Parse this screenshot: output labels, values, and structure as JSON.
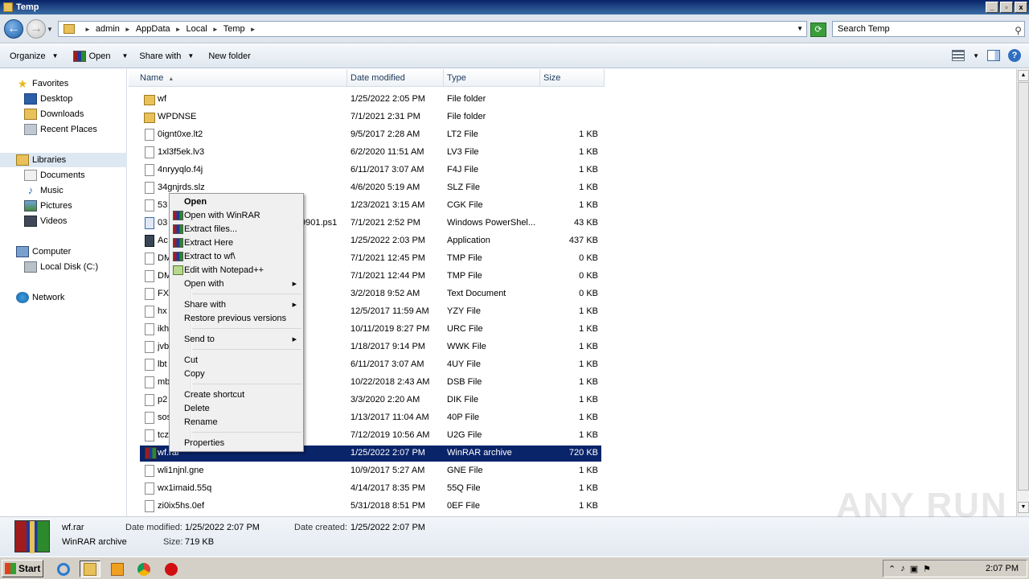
{
  "window": {
    "title": "Temp",
    "buttons": [
      "_",
      "▫",
      "x"
    ]
  },
  "address": {
    "crumbs": [
      "admin",
      "AppData",
      "Local",
      "Temp"
    ],
    "search_placeholder": "Search Temp"
  },
  "toolbar": {
    "organize": "Organize",
    "open": "Open",
    "share_with": "Share with",
    "new_folder": "New folder"
  },
  "nav": {
    "favorites": "Favorites",
    "desktop": "Desktop",
    "downloads": "Downloads",
    "recent_places": "Recent Places",
    "libraries": "Libraries",
    "documents": "Documents",
    "music": "Music",
    "pictures": "Pictures",
    "videos": "Videos",
    "computer": "Computer",
    "local_disk": "Local Disk (C:)",
    "network": "Network"
  },
  "columns": {
    "name": "Name",
    "date": "Date modified",
    "type": "Type",
    "size": "Size"
  },
  "files": [
    {
      "name": "wf",
      "date": "1/25/2022 2:05 PM",
      "type": "File folder",
      "size": "",
      "icon": "folder"
    },
    {
      "name": "WPDNSE",
      "date": "7/1/2021 2:31 PM",
      "type": "File folder",
      "size": "",
      "icon": "folder"
    },
    {
      "name": "0ignt0xe.lt2",
      "date": "9/5/2017 2:28 AM",
      "type": "LT2 File",
      "size": "1 KB",
      "icon": "file"
    },
    {
      "name": "1xl3f5ek.lv3",
      "date": "6/2/2020 11:51 AM",
      "type": "LV3 File",
      "size": "1 KB",
      "icon": "file"
    },
    {
      "name": "4nryyqlo.f4j",
      "date": "6/11/2017 3:07 AM",
      "type": "F4J File",
      "size": "1 KB",
      "icon": "file"
    },
    {
      "name": "34gnjrds.slz",
      "date": "4/6/2020 5:19 AM",
      "type": "SLZ File",
      "size": "1 KB",
      "icon": "file"
    },
    {
      "name": "53",
      "date": "1/23/2021 3:15 AM",
      "type": "CGK File",
      "size": "1 KB",
      "icon": "file"
    },
    {
      "name": "03",
      "name_tail": "9901.ps1",
      "date": "7/1/2021 2:52 PM",
      "type": "Windows PowerShel...",
      "size": "43 KB",
      "icon": "ps"
    },
    {
      "name": "Ac",
      "date": "1/25/2022 2:03 PM",
      "type": "Application",
      "size": "437 KB",
      "icon": "app"
    },
    {
      "name": "DM",
      "date": "7/1/2021 12:45 PM",
      "type": "TMP File",
      "size": "0 KB",
      "icon": "file"
    },
    {
      "name": "DM",
      "date": "7/1/2021 12:44 PM",
      "type": "TMP File",
      "size": "0 KB",
      "icon": "file"
    },
    {
      "name": "FX",
      "date": "3/2/2018 9:52 AM",
      "type": "Text Document",
      "size": "0 KB",
      "icon": "file"
    },
    {
      "name": "hx",
      "date": "12/5/2017 11:59 AM",
      "type": "YZY File",
      "size": "1 KB",
      "icon": "file"
    },
    {
      "name": "ikh",
      "date": "10/11/2019 8:27 PM",
      "type": "URC File",
      "size": "1 KB",
      "icon": "file"
    },
    {
      "name": "jvb",
      "date": "1/18/2017 9:14 PM",
      "type": "WWK File",
      "size": "1 KB",
      "icon": "file"
    },
    {
      "name": "lbt",
      "date": "6/11/2017 3:07 AM",
      "type": "4UY File",
      "size": "1 KB",
      "icon": "file"
    },
    {
      "name": "mb",
      "date": "10/22/2018 2:43 AM",
      "type": "DSB File",
      "size": "1 KB",
      "icon": "file"
    },
    {
      "name": "p2",
      "date": "3/3/2020 2:20 AM",
      "type": "DIK File",
      "size": "1 KB",
      "icon": "file"
    },
    {
      "name": "sos",
      "date": "1/13/2017 11:04 AM",
      "type": "40P File",
      "size": "1 KB",
      "icon": "file"
    },
    {
      "name": "tcz",
      "date": "7/12/2019 10:56 AM",
      "type": "U2G File",
      "size": "1 KB",
      "icon": "file"
    },
    {
      "name": "wf.rar",
      "date": "1/25/2022 2:07 PM",
      "type": "WinRAR archive",
      "size": "720 KB",
      "icon": "rar",
      "selected": true
    },
    {
      "name": "wli1njnl.gne",
      "date": "10/9/2017 5:27 AM",
      "type": "GNE File",
      "size": "1 KB",
      "icon": "file"
    },
    {
      "name": "wx1imaid.55q",
      "date": "4/14/2017 8:35 PM",
      "type": "55Q File",
      "size": "1 KB",
      "icon": "file"
    },
    {
      "name": "zi0ix5hs.0ef",
      "date": "5/31/2018 8:51 PM",
      "type": "0EF File",
      "size": "1 KB",
      "icon": "file"
    }
  ],
  "context_menu": {
    "open": "Open",
    "open_with_winrar": "Open with WinRAR",
    "extract_files": "Extract files...",
    "extract_here": "Extract Here",
    "extract_to": "Extract to wf\\",
    "edit_notepad": "Edit with Notepad++",
    "open_with": "Open with",
    "share_with": "Share with",
    "restore": "Restore previous versions",
    "send_to": "Send to",
    "cut": "Cut",
    "copy": "Copy",
    "create_shortcut": "Create shortcut",
    "delete": "Delete",
    "rename": "Rename",
    "properties": "Properties"
  },
  "details": {
    "filename": "wf.rar",
    "filetype": "WinRAR archive",
    "date_modified_label": "Date modified:",
    "date_modified": "1/25/2022 2:07 PM",
    "size_label": "Size:",
    "size": "719 KB",
    "date_created_label": "Date created:",
    "date_created": "1/25/2022 2:07 PM"
  },
  "watermark": "ANY RUN",
  "taskbar": {
    "start": "Start",
    "clock": "2:07 PM"
  }
}
